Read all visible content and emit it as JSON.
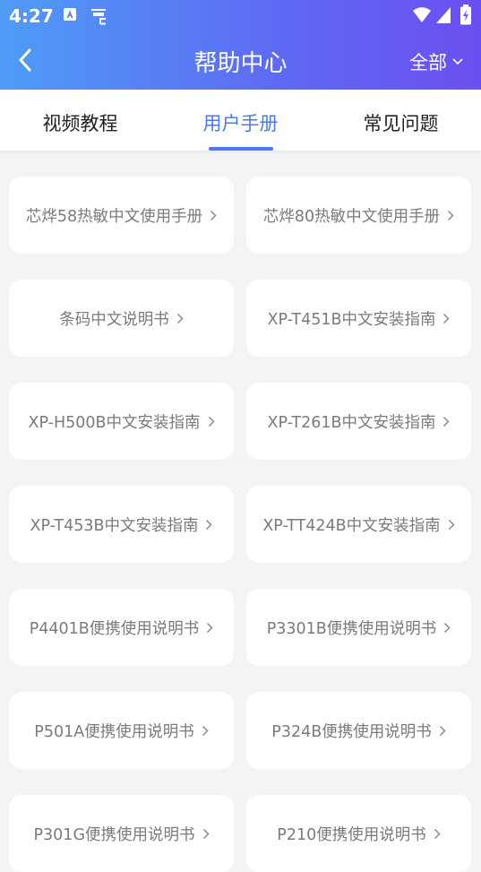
{
  "status_bar": {
    "time": "4:27"
  },
  "header": {
    "title": "帮助中心",
    "filter_label": "全部"
  },
  "tabs": [
    {
      "label": "视频教程",
      "active": false
    },
    {
      "label": "用户手册",
      "active": true
    },
    {
      "label": "常见问题",
      "active": false
    }
  ],
  "manuals": [
    {
      "label": "芯烨58热敏中文使用手册"
    },
    {
      "label": "芯烨80热敏中文使用手册"
    },
    {
      "label": "条码中文说明书"
    },
    {
      "label": "XP-T451B中文安装指南"
    },
    {
      "label": "XP-H500B中文安装指南"
    },
    {
      "label": "XP-T261B中文安装指南"
    },
    {
      "label": "XP-T453B中文安装指南"
    },
    {
      "label": "XP-TT424B中文安装指南"
    },
    {
      "label": "P4401B便携使用说明书"
    },
    {
      "label": "P3301B便携使用说明书"
    },
    {
      "label": "P501A便携使用说明书"
    },
    {
      "label": "P324B便携使用说明书"
    },
    {
      "label": "P301G便携使用说明书"
    },
    {
      "label": "P210便携使用说明书"
    }
  ],
  "colors": {
    "accent": "#4a78f1",
    "header_start": "#4f9cf6",
    "header_end": "#6a4ff0",
    "card_text": "#7b7b7b"
  }
}
